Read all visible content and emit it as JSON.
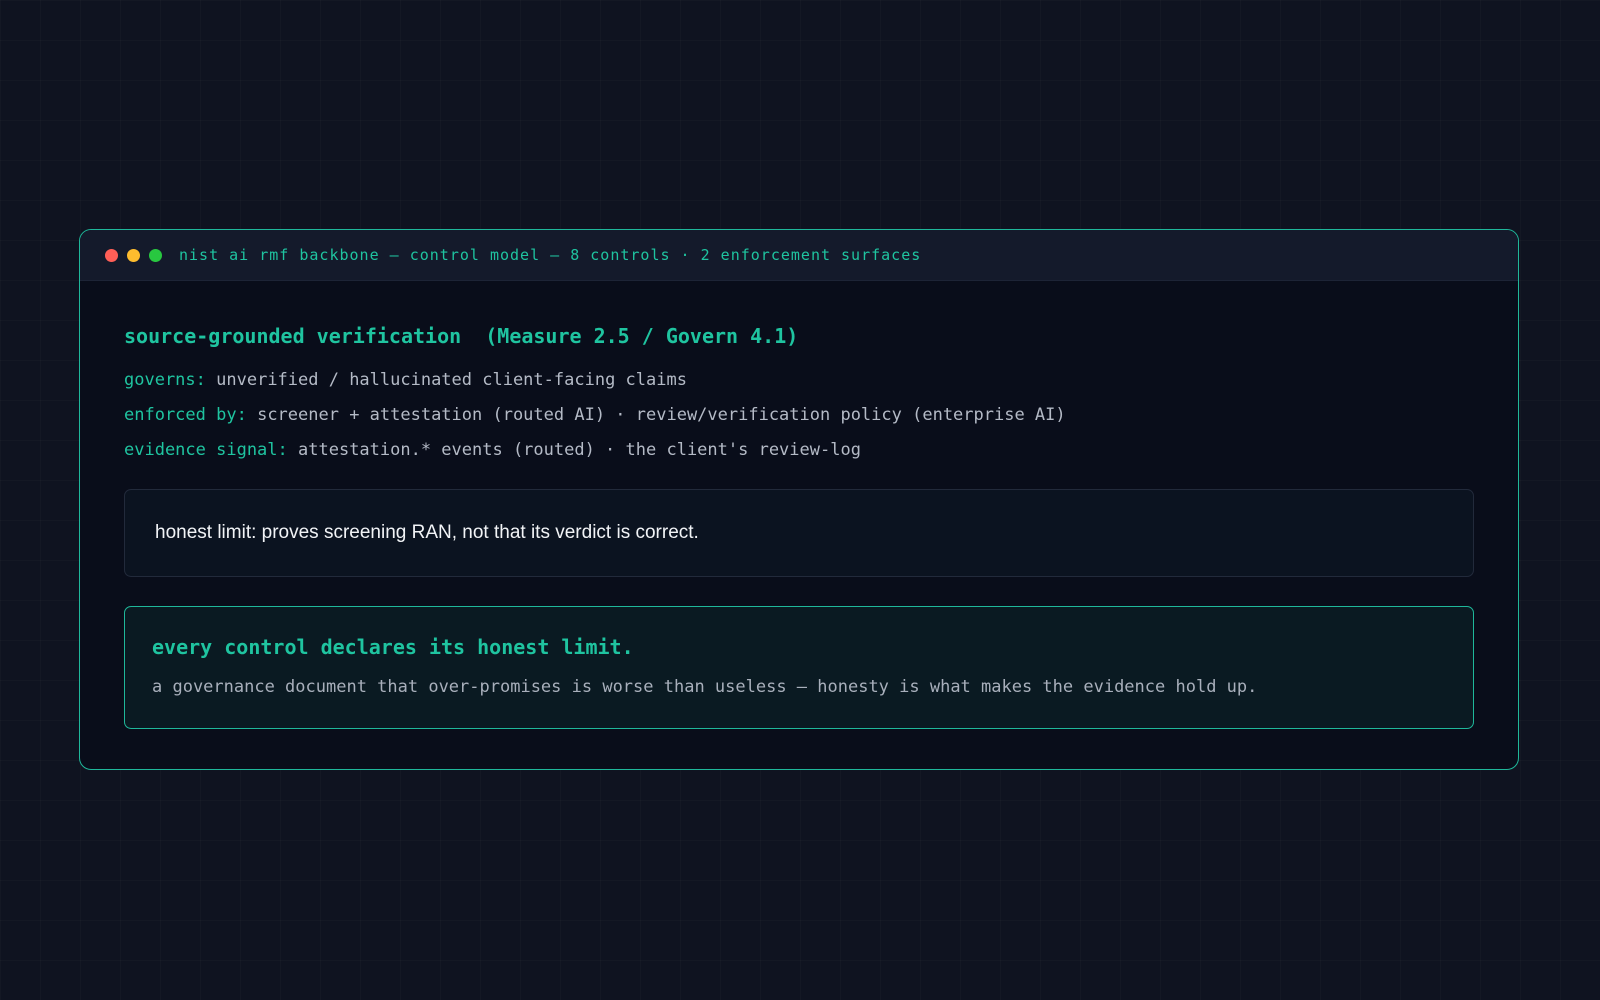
{
  "window": {
    "title": "nist ai rmf backbone — control model — 8 controls · 2 enforcement surfaces",
    "dots": [
      {
        "name": "close",
        "color": "#ff5f57"
      },
      {
        "name": "minimize",
        "color": "#febc2e"
      },
      {
        "name": "maximize",
        "color": "#28c840"
      }
    ]
  },
  "control": {
    "heading": "source-grounded verification  (Measure 2.5 / Govern 4.1)",
    "rows": [
      {
        "key": "governs:",
        "value": "unverified / hallucinated client-facing claims"
      },
      {
        "key": "enforced by:",
        "value": "screener + attestation (routed AI) · review/verification policy (enterprise AI)"
      },
      {
        "key": "evidence signal:",
        "value": "attestation.* events (routed) · the client's review-log"
      }
    ],
    "honest_limit": "honest limit: proves screening RAN, not that its verdict is correct."
  },
  "principle": {
    "title": "every control declares its honest limit.",
    "body": "a governance document that over-promises is worse than useless — honesty is what makes the evidence hold up."
  },
  "colors": {
    "accent": "#1fc4a0",
    "background": "#0f1320",
    "panel": "#090d1a"
  }
}
